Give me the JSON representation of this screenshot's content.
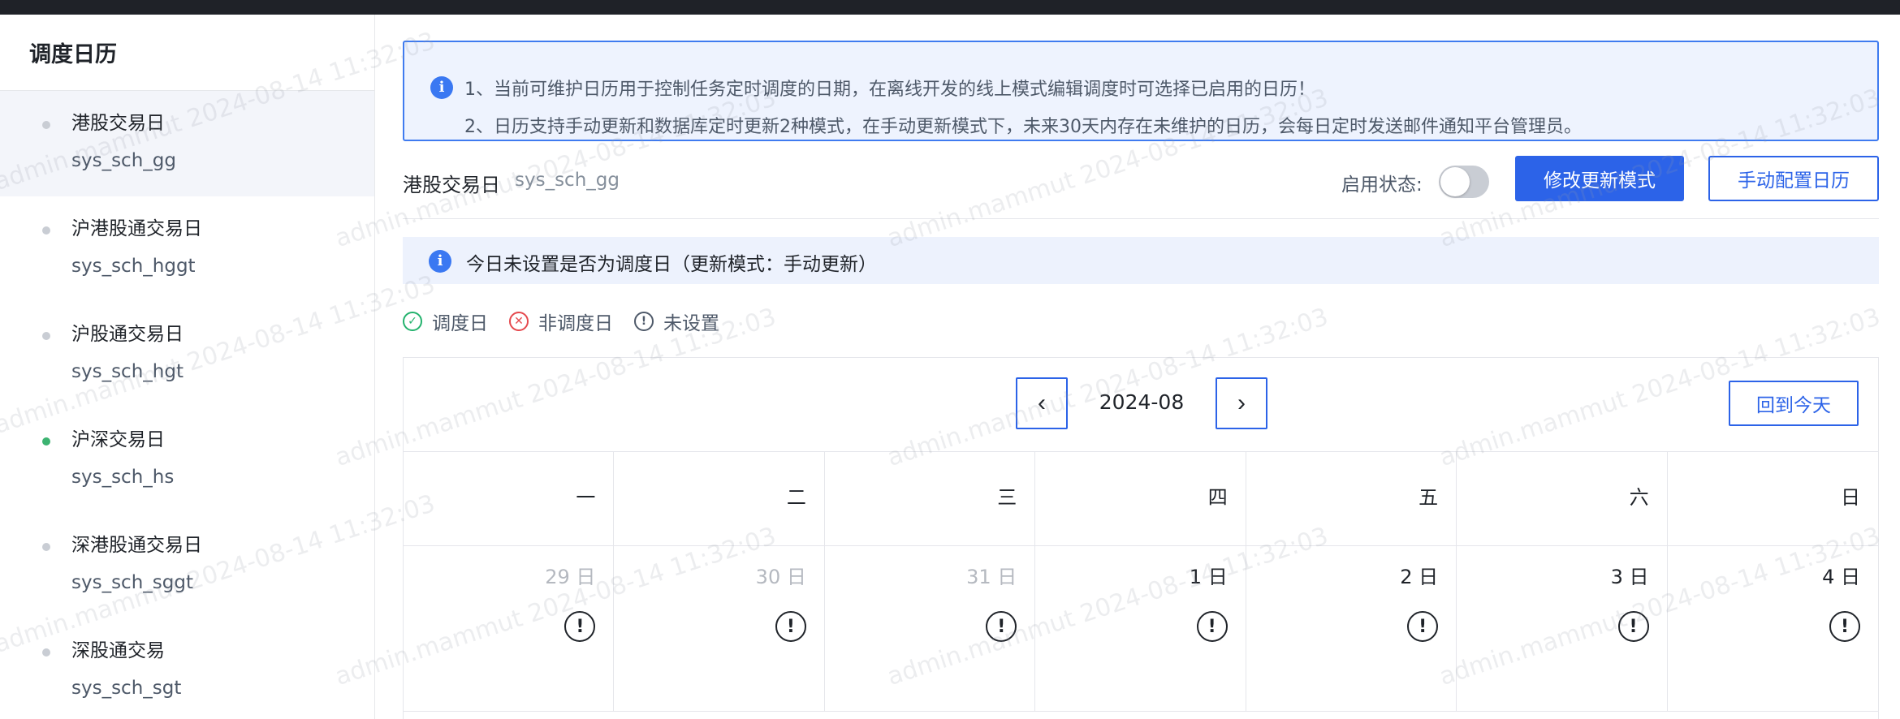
{
  "sidebar": {
    "title": "调度日历",
    "items": [
      {
        "name": "港股交易日",
        "code": "sys_sch_gg"
      },
      {
        "name": "沪港股通交易日",
        "code": "sys_sch_hggt"
      },
      {
        "name": "沪股通交易日",
        "code": "sys_sch_hgt"
      },
      {
        "name": "沪深交易日",
        "code": "sys_sch_hs"
      },
      {
        "name": "深港股通交易日",
        "code": "sys_sch_sggt"
      },
      {
        "name": "深股通交易",
        "code": "sys_sch_sgt"
      }
    ]
  },
  "notice": {
    "line1": "1、当前可维护日历用于控制任务定时调度的日期，在离线开发的线上模式编辑调度时可选择已启用的日历！",
    "line2": "2、日历支持手动更新和数据库定时更新2种模式，在手动更新模式下，未来30天内存在未维护的日历，会每日定时发送邮件通知平台管理员。"
  },
  "header": {
    "title": "港股交易日",
    "code": "sys_sch_gg",
    "status_label": "启用状态:",
    "modify_button": "修改更新模式",
    "manual_button": "手动配置日历"
  },
  "today_notice": "今日未设置是否为调度日（更新模式：手动更新）",
  "legend": {
    "scheduled": "调度日",
    "not_scheduled": "非调度日",
    "unset": "未设置"
  },
  "calendar": {
    "month": "2024-08",
    "prev_icon": "‹",
    "next_icon": "›",
    "today_button": "回到今天",
    "weekdays": [
      "一",
      "二",
      "三",
      "四",
      "五",
      "六",
      "日"
    ],
    "days": [
      "29 日",
      "30 日",
      "31 日",
      "1 日",
      "2 日",
      "3 日",
      "4 日"
    ],
    "state_symbol": "!"
  },
  "watermark": "admin.mammut 2024-08-14 11:32:03",
  "colors": {
    "primary": "#2c63e8",
    "notice_bg": "#eef3fe",
    "active_dot": "#3cb371"
  }
}
